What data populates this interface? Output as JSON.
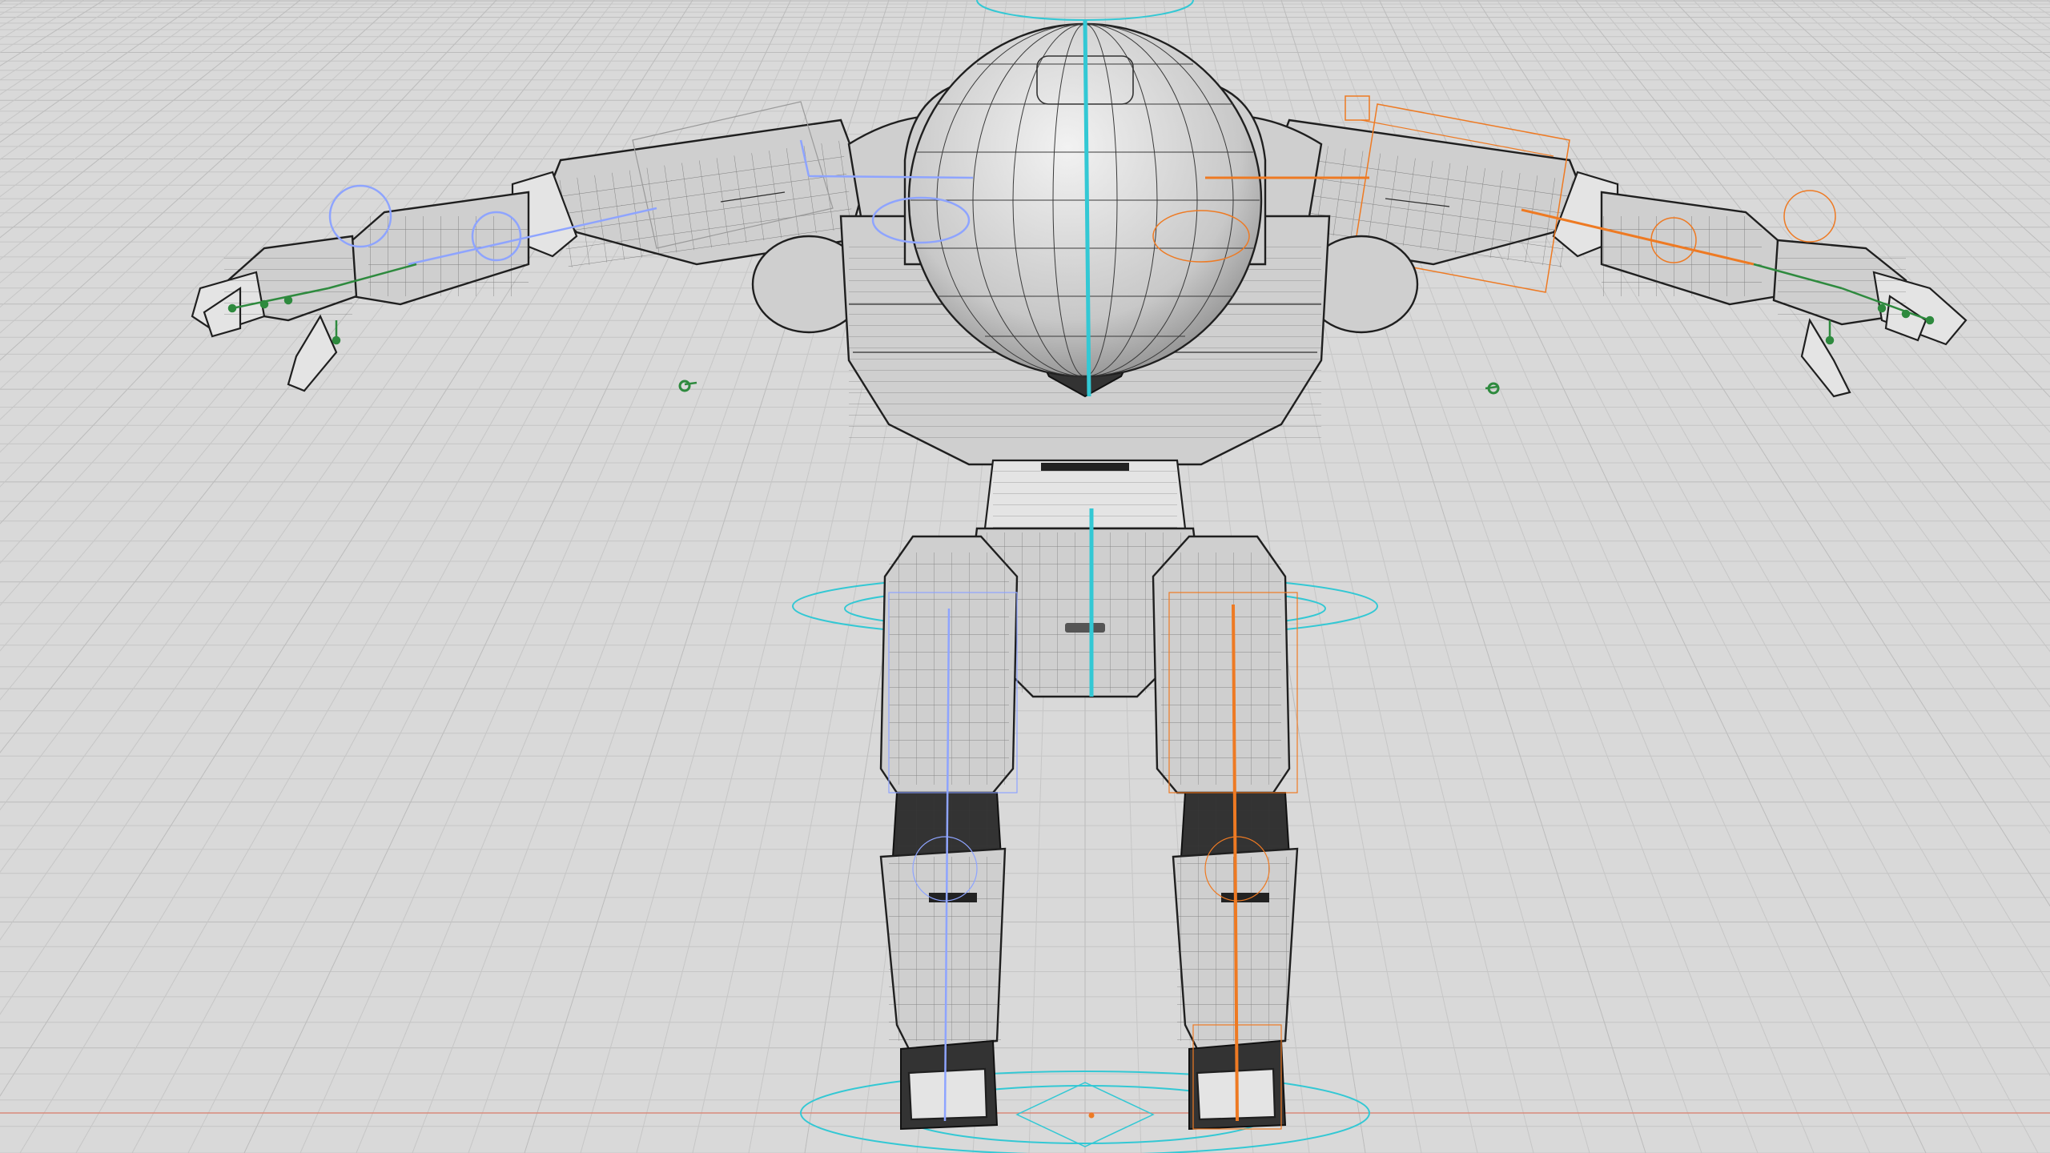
{
  "viewport": {
    "background": "#d9d9d9",
    "grid_color": "#c6c6c6",
    "grid_major_color": "#bcbcbc",
    "x_axis_color": "#d98a7a"
  },
  "rig": {
    "center_bone_color": "#33c8d4",
    "left_side_color": "#8ea4ff",
    "right_side_color": "#ee7a23",
    "finger_bone_color": "#2e8a3e",
    "mesh_wire_color": "#2e2e2e"
  }
}
